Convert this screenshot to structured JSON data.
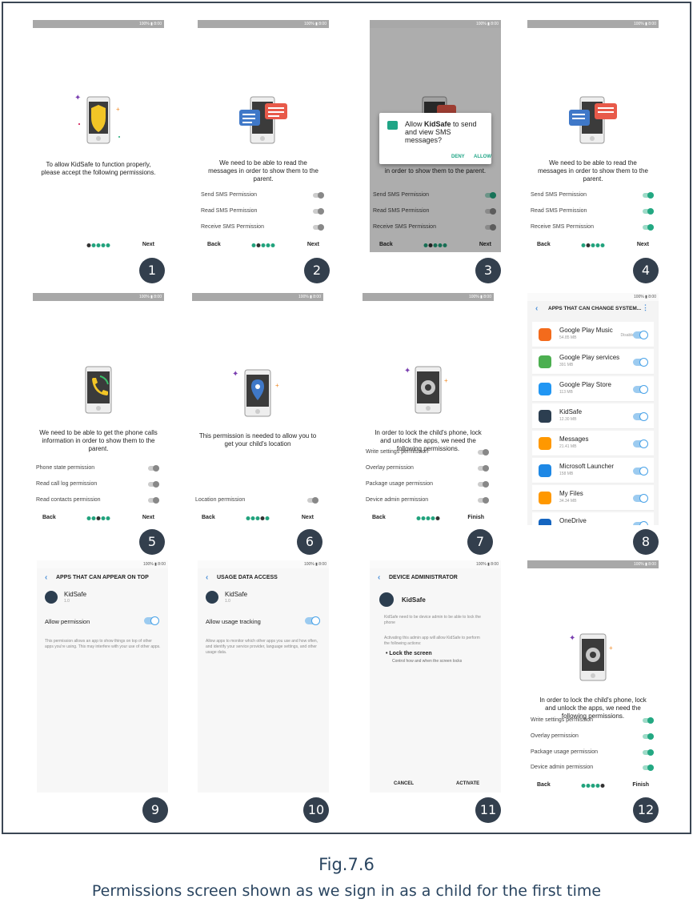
{
  "status_text": "100% ▮ 8:00",
  "common": {
    "next": "Next",
    "back": "Back",
    "finish": "Finish"
  },
  "s1": {
    "number": "1",
    "message": "To allow KidSafe to function properly, please accept the following permissions."
  },
  "s2": {
    "number": "2",
    "message": "We need to be able to read the messages in order to show them to the parent.",
    "perms": [
      "Send SMS Permission",
      "Read SMS Permission",
      "Receive SMS Permission"
    ]
  },
  "s3": {
    "number": "3",
    "dialog_pre": "Allow ",
    "dialog_app": "KidSafe",
    "dialog_post": " to send and view SMS messages?",
    "deny": "DENY",
    "allow": "ALLOW",
    "message_visible": "in order to show them to the parent."
  },
  "s4": {
    "number": "4"
  },
  "s5": {
    "number": "5",
    "message": "We need to be able to get the phone calls information in order to show them to the parent.",
    "perms": [
      "Phone state permission",
      "Read call log permission",
      "Read contacts permission"
    ]
  },
  "s6": {
    "number": "6",
    "message": "This permission is needed to allow you to get your child's location",
    "perms": [
      "Location permission"
    ]
  },
  "s7": {
    "number": "7",
    "message": "In order to lock the child's phone, lock and unlock the apps, we need the following permissions.",
    "perms": [
      "Write settings permission",
      "Overlay permission",
      "Package usage permission",
      "Device admin permission"
    ]
  },
  "s8": {
    "number": "8",
    "title": "APPS THAT CAN CHANGE SYSTEM...",
    "apps": [
      {
        "name": "Google Play Music",
        "size": "54.85 MB",
        "note": "Disabled",
        "color": "#f36b1c"
      },
      {
        "name": "Google Play services",
        "size": "391 MB",
        "note": "",
        "color": "#4caf50"
      },
      {
        "name": "Google Play Store",
        "size": "113 MB",
        "note": "",
        "color": "#2196f3"
      },
      {
        "name": "KidSafe",
        "size": "12.30 MB",
        "note": "",
        "color": "#2c3e50"
      },
      {
        "name": "Messages",
        "size": "21.41 MB",
        "note": "",
        "color": "#ff9800"
      },
      {
        "name": "Microsoft Launcher",
        "size": "158 MB",
        "note": "",
        "color": "#1e88e5"
      },
      {
        "name": "My Files",
        "size": "34.34 MB",
        "note": "",
        "color": "#ff9800"
      },
      {
        "name": "OneDrive",
        "size": "",
        "note": "",
        "color": "#1565c0"
      }
    ]
  },
  "s9": {
    "number": "9",
    "title": "APPS THAT CAN APPEAR ON TOP",
    "app": "KidSafe",
    "version": "1.0",
    "toggle_label": "Allow permission",
    "desc": "This permission allows an app to show things on top of other apps you're using. This may interfere with your use of other apps."
  },
  "s10": {
    "number": "10",
    "title": "USAGE DATA ACCESS",
    "app": "KidSafe",
    "version": "1.0",
    "toggle_label": "Allow usage tracking",
    "desc": "Allow apps to monitor which other apps you use and how often, and identify your service provider, language settings, and other usage data."
  },
  "s11": {
    "number": "11",
    "title": "DEVICE ADMINISTRATOR",
    "app": "KidSafe",
    "desc1": "KidSafe need to be device admin to be able to lock the phone",
    "desc2": "Activating this admin app will allow KidSafe to perform the following actions:",
    "bullet_title": "Lock the screen",
    "bullet_desc": "Control how and when the screen locks",
    "cancel": "CANCEL",
    "activate": "ACTIVATE"
  },
  "s12": {
    "number": "12"
  },
  "caption": {
    "fig": "Fig.7.6",
    "text": "Permissions screen shown as we sign in as a child for the first time"
  },
  "colors": {
    "badge": "#333f4d",
    "toggle_on": "#23a882",
    "accent_blue": "#4a8fd8",
    "caption": "#2a4560"
  }
}
